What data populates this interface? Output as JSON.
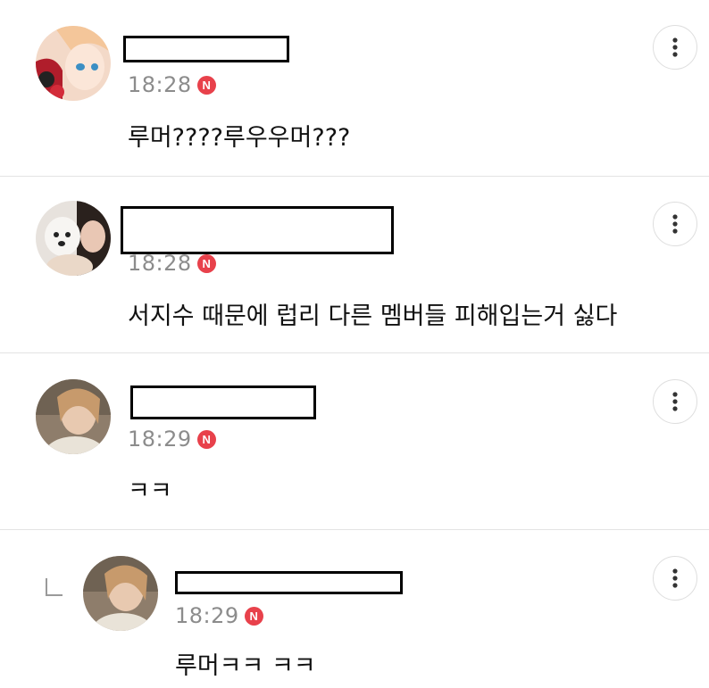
{
  "comments": [
    {
      "time": "18:28",
      "badge": "N",
      "text": "루머????루우우머???",
      "avatar_icon": "anime-avatar",
      "more_icon": "more-vertical-icon"
    },
    {
      "time": "18:28",
      "badge": "N",
      "text": "서지수 때문에 럽리 다른 멤버들 피해입는거 싫다",
      "avatar_icon": "dog-photo-avatar",
      "more_icon": "more-vertical-icon"
    },
    {
      "time": "18:29",
      "badge": "N",
      "text": "ㅋㅋ",
      "avatar_icon": "portrait-avatar",
      "more_icon": "more-vertical-icon"
    },
    {
      "time": "18:29",
      "badge": "N",
      "text": "루머ㅋㅋ ㅋㅋ",
      "avatar_icon": "portrait-avatar",
      "more_icon": "more-vertical-icon",
      "is_reply": true
    }
  ],
  "colors": {
    "badge": "#e8414b",
    "time": "#8c8c8c",
    "divider": "#e3e3e3"
  }
}
